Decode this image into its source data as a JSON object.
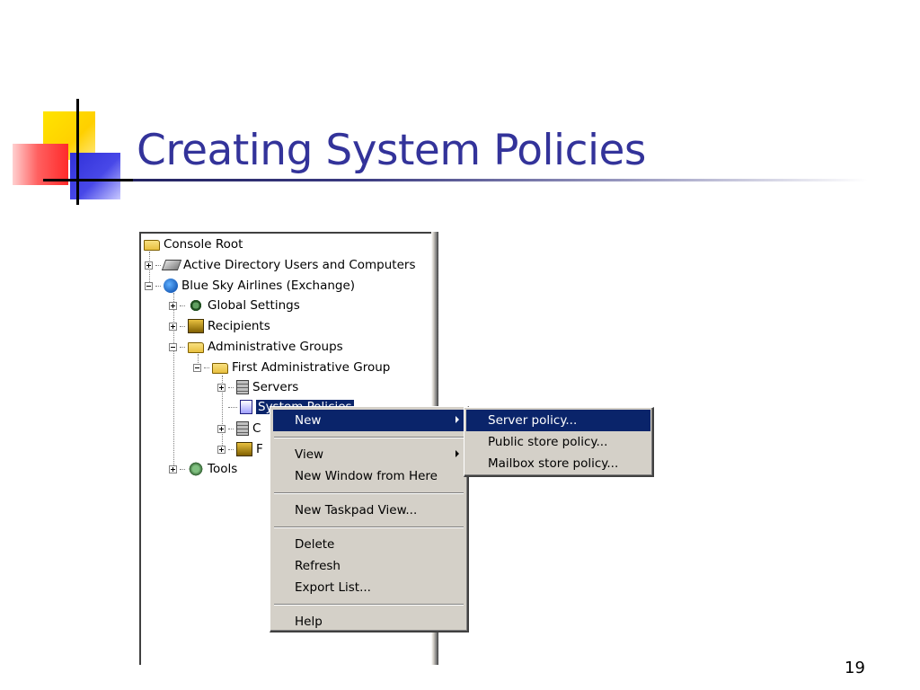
{
  "slide": {
    "title": "Creating System Policies",
    "page_number": "19"
  },
  "colors": {
    "title": "#33339a",
    "menu_highlight": "#0a246a",
    "menu_background": "#d4d0c8"
  },
  "tree": {
    "items": [
      {
        "label": "Console Root",
        "icon": "folder-icon"
      },
      {
        "label": "Active Directory Users and Computers",
        "icon": "book-icon"
      },
      {
        "label": "Blue Sky Airlines (Exchange)",
        "icon": "globe-icon"
      },
      {
        "label": "Global Settings",
        "icon": "gear-icon"
      },
      {
        "label": "Recipients",
        "icon": "recipients-icon"
      },
      {
        "label": "Administrative Groups",
        "icon": "folder-icon"
      },
      {
        "label": "First Administrative Group",
        "icon": "folder-icon"
      },
      {
        "label": "Servers",
        "icon": "servers-icon"
      },
      {
        "label": "System Policies",
        "icon": "policy-icon"
      },
      {
        "label": "C",
        "icon": "routing-icon"
      },
      {
        "label": "F",
        "icon": "folders-icon"
      },
      {
        "label": "Tools",
        "icon": "tools-icon"
      }
    ]
  },
  "context_menu": {
    "new": "New",
    "view": "View",
    "new_window": "New Window from Here",
    "new_taskpad": "New Taskpad View...",
    "delete": "Delete",
    "refresh": "Refresh",
    "export_list": "Export List...",
    "help": "Help"
  },
  "submenu": {
    "server_policy": "Server policy...",
    "public_store_policy": "Public store policy...",
    "mailbox_store_policy": "Mailbox store policy..."
  }
}
